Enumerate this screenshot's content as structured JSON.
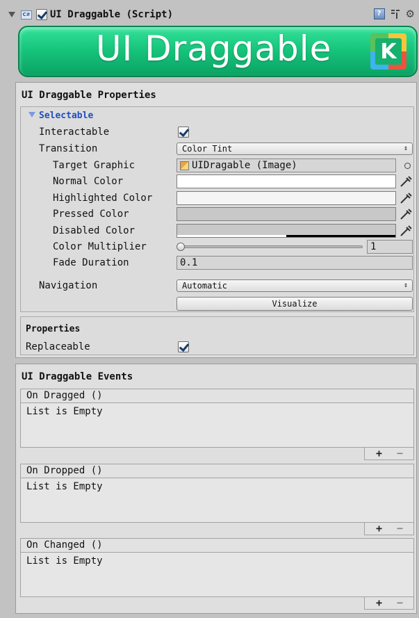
{
  "header": {
    "title": "UI Draggable (Script)",
    "enabled": true,
    "script_icon": "C#",
    "icons": [
      "foldout-arrow-icon",
      "csharp-script-icon",
      "help-icon",
      "presets-icon",
      "gear-icon"
    ]
  },
  "banner": {
    "text": "UI Draggable",
    "logo_letter": "K"
  },
  "properties_section": {
    "title": "UI Draggable Properties",
    "selectable": {
      "foldout_label": "Selectable",
      "interactable_label": "Interactable",
      "interactable_checked": true,
      "transition_label": "Transition",
      "transition_value": "Color Tint",
      "target_graphic_label": "Target Graphic",
      "target_graphic_value": "UIDragable (Image)",
      "normal_color_label": "Normal Color",
      "normal_color": "#ffffff",
      "highlighted_color_label": "Highlighted Color",
      "highlighted_color": "#f5f5f5",
      "pressed_color_label": "Pressed Color",
      "pressed_color": "#c8c8c8",
      "disabled_color_label": "Disabled Color",
      "disabled_color": "#c8c8c8",
      "color_multiplier_label": "Color Multiplier",
      "color_multiplier_value": "1",
      "fade_duration_label": "Fade Duration",
      "fade_duration_value": "0.1",
      "navigation_label": "Navigation",
      "navigation_value": "Automatic",
      "visualize_label": "Visualize"
    },
    "properties": {
      "title": "Properties",
      "replaceable_label": "Replaceable",
      "replaceable_checked": true
    }
  },
  "events_section": {
    "title": "UI Draggable Events",
    "events": [
      {
        "name": "On Dragged ()",
        "empty_text": "List is Empty"
      },
      {
        "name": "On Dropped ()",
        "empty_text": "List is Empty"
      },
      {
        "name": "On Changed ()",
        "empty_text": "List is Empty"
      }
    ],
    "add_label": "+",
    "remove_label": "−"
  },
  "colors": {
    "banner_green": "#17c57c",
    "foldout_blue": "#1f4fbf",
    "panel_bg": "#dfdfdf"
  }
}
